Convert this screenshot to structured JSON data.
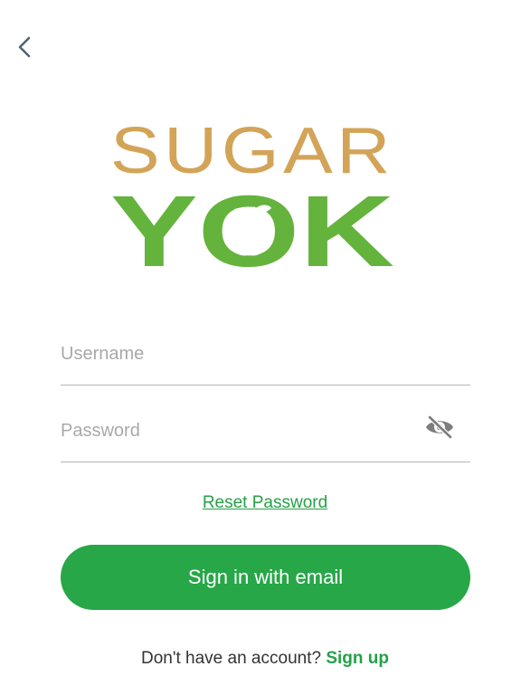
{
  "header": {
    "back_icon": "chevron-left-icon"
  },
  "logo": {
    "line1": "SUGAR",
    "line2": "YOK",
    "colors": {
      "gold": "#d3a458",
      "green": "#64b33d"
    }
  },
  "form": {
    "username": {
      "placeholder": "Username",
      "value": ""
    },
    "password": {
      "placeholder": "Password",
      "value": "",
      "toggle_icon": "eye-off-icon"
    },
    "reset_label": "Reset Password",
    "signin_label": "Sign in with email"
  },
  "footer": {
    "prompt": "Don't have an account?",
    "signup_label": "Sign up"
  },
  "colors": {
    "accent": "#27a748",
    "divider": "#b5b5b5"
  }
}
